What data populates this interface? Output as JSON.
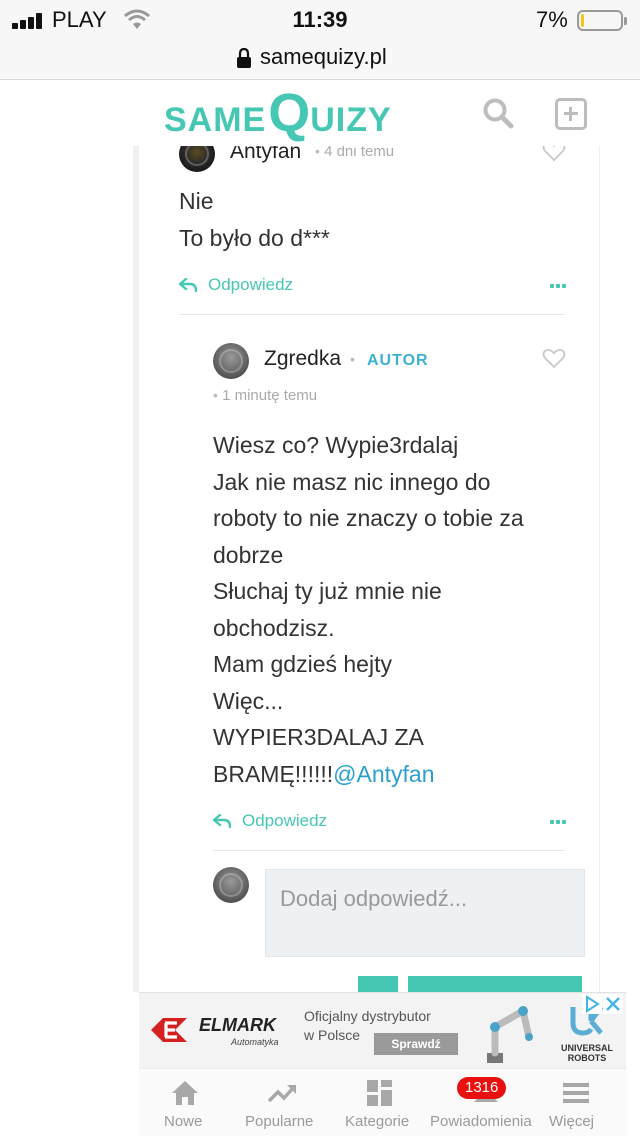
{
  "status_bar": {
    "carrier": "PLAY",
    "time": "11:39",
    "battery_percent": "7%",
    "battery_level": 0.07,
    "battery_color": "#f5c518"
  },
  "browser": {
    "url": "samequizy.pl",
    "lock_icon": "lock-icon"
  },
  "header": {
    "logo_same": "SAME",
    "logo_q": "Q",
    "logo_uizy": "UIZY",
    "brand_color": "#46c7b3",
    "search_icon": "search-icon",
    "add_icon": "plus-square-icon"
  },
  "comments": [
    {
      "author": "Antyfan",
      "time": "4 dni temu",
      "text": "Nie\nTo było do d***",
      "reply_label": "Odpowiedz"
    },
    {
      "author": "Zgredka",
      "badge": "AUTOR",
      "time": "1 minutę temu",
      "text": "Wiesz co? Wypie3rdalaj\nJak nie masz nic innego do\nroboty to nie znaczy o tobie za\ndobrze\nSłuchaj ty już mnie nie\nobchodzisz.\nMam gdzieś hejty\nWięc...\nWYPIER3DALAJ ZA\nBRAMĘ!!!!!!",
      "mention": "@Antyfan",
      "reply_label": "Odpowiedz"
    }
  ],
  "reply_input": {
    "placeholder": "Dodaj odpowiedź..."
  },
  "ad": {
    "brand": "ELMARK",
    "brand_sub": "Automatyka",
    "text": "Oficjalny dystrybutor\nw Polsce",
    "button": "Sprawdź",
    "partner": "UNIVERSAL\nROBOTS"
  },
  "bottom_nav": {
    "items": [
      {
        "label": "Nowe",
        "icon": "home-icon"
      },
      {
        "label": "Popularne",
        "icon": "trending-icon"
      },
      {
        "label": "Kategorie",
        "icon": "grid-icon"
      },
      {
        "label": "Powiadomienia",
        "icon": "bell-icon",
        "badge": "1316"
      },
      {
        "label": "Więcej",
        "icon": "menu-icon"
      }
    ]
  }
}
